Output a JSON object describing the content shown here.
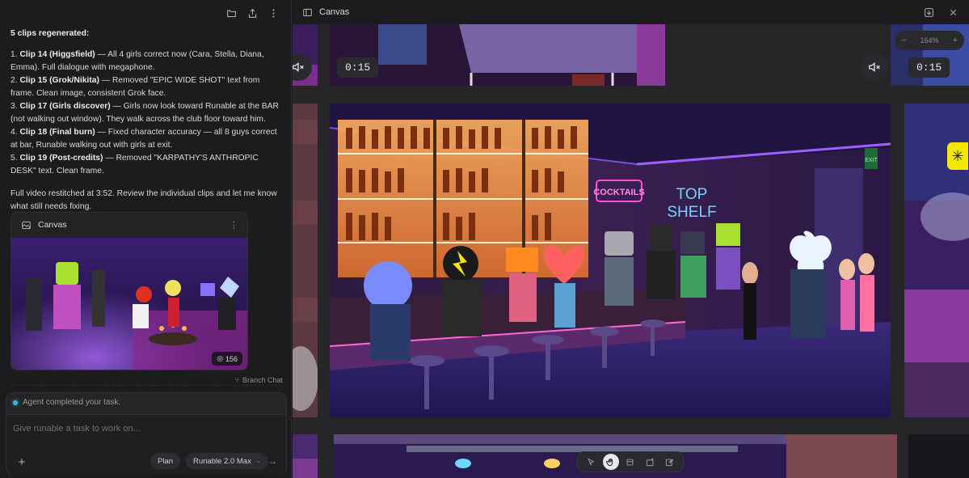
{
  "chat": {
    "heading": "5 clips regenerated:",
    "items": [
      {
        "num": "1.",
        "title": "Clip 14 (Higgsfield)",
        "text": " — All 4 girls correct now (Cara, Stella, Diana, Emma). Full dialogue with megaphone."
      },
      {
        "num": "2.",
        "title": "Clip 15 (Grok/Nikita)",
        "text": " — Removed \"EPIC WIDE SHOT\" text from frame. Clean image, consistent Grok face."
      },
      {
        "num": "3.",
        "title": "Clip 17 (Girls discover)",
        "text": " — Girls now look toward Runable at the BAR (not walking out window). They walk across the club floor toward him."
      },
      {
        "num": "4.",
        "title": "Clip 18 (Final burn)",
        "text": " — Fixed character accuracy — all 8 guys correct at bar, Runable walking out with girls at exit."
      },
      {
        "num": "5.",
        "title": "Clip 19 (Post-credits)",
        "text": " — Removed \"KARPATHY'S ANTHROPIC DESK\" text. Clean frame."
      }
    ],
    "footer": "Full video restitched at 3:52. Review the individual clips and let me know what still needs fixing."
  },
  "canvas_card": {
    "title": "Canvas",
    "count": "156"
  },
  "branch_chat": "Branch Chat",
  "composer": {
    "status": "Agent completed your task.",
    "placeholder": "Give runable a task to work on...",
    "plan_label": "Plan",
    "model_label": "Runable 2.0 Max"
  },
  "canvas_panel": {
    "title": "Canvas",
    "zoom": "164%",
    "timecode_left": "0:15",
    "timecode_right": "0:15"
  },
  "bar_scene": {
    "sign_cocktails": "COCKTAILS",
    "sign_top": "TOP",
    "sign_shelf": "SHELF",
    "sign_exit": "EXIT"
  },
  "colors": {
    "panel_bg": "#1c1c1e",
    "canvas_bg": "#262629",
    "status_dot": "#36b6d8",
    "neon_pink": "#ff4fd8",
    "neon_blue": "#6fd6ff"
  }
}
